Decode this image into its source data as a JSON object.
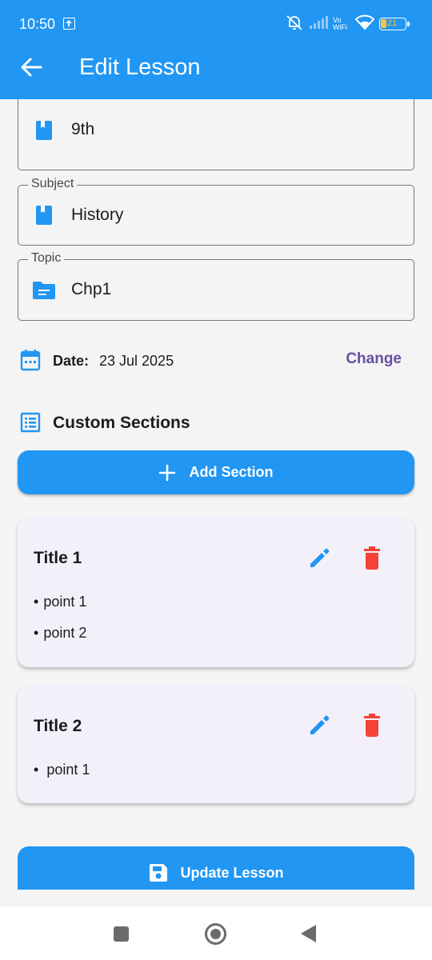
{
  "status_bar": {
    "time": "10:50",
    "network_label": "Vo WiFi",
    "battery": "21"
  },
  "toolbar": {
    "title": "Edit Lesson"
  },
  "form": {
    "grade": {
      "value": "9th"
    },
    "subject": {
      "label": "Subject",
      "value": "History"
    },
    "topic": {
      "label": "Topic",
      "value": "Chp1"
    }
  },
  "date": {
    "label": "Date:",
    "value": "23 Jul 2025",
    "change_label": "Change"
  },
  "custom_sections": {
    "title": "Custom Sections",
    "add_label": "Add Section",
    "cards": [
      {
        "title": "Title 1",
        "points": [
          "point 1",
          "point 2"
        ]
      },
      {
        "title": "Title 2",
        "points": [
          "point 1"
        ]
      }
    ]
  },
  "update_label": "Update Lesson",
  "colors": {
    "primary": "#2196f3",
    "delete": "#f44336",
    "change_link": "#6750a4",
    "card_background": "#f4f0f9"
  }
}
